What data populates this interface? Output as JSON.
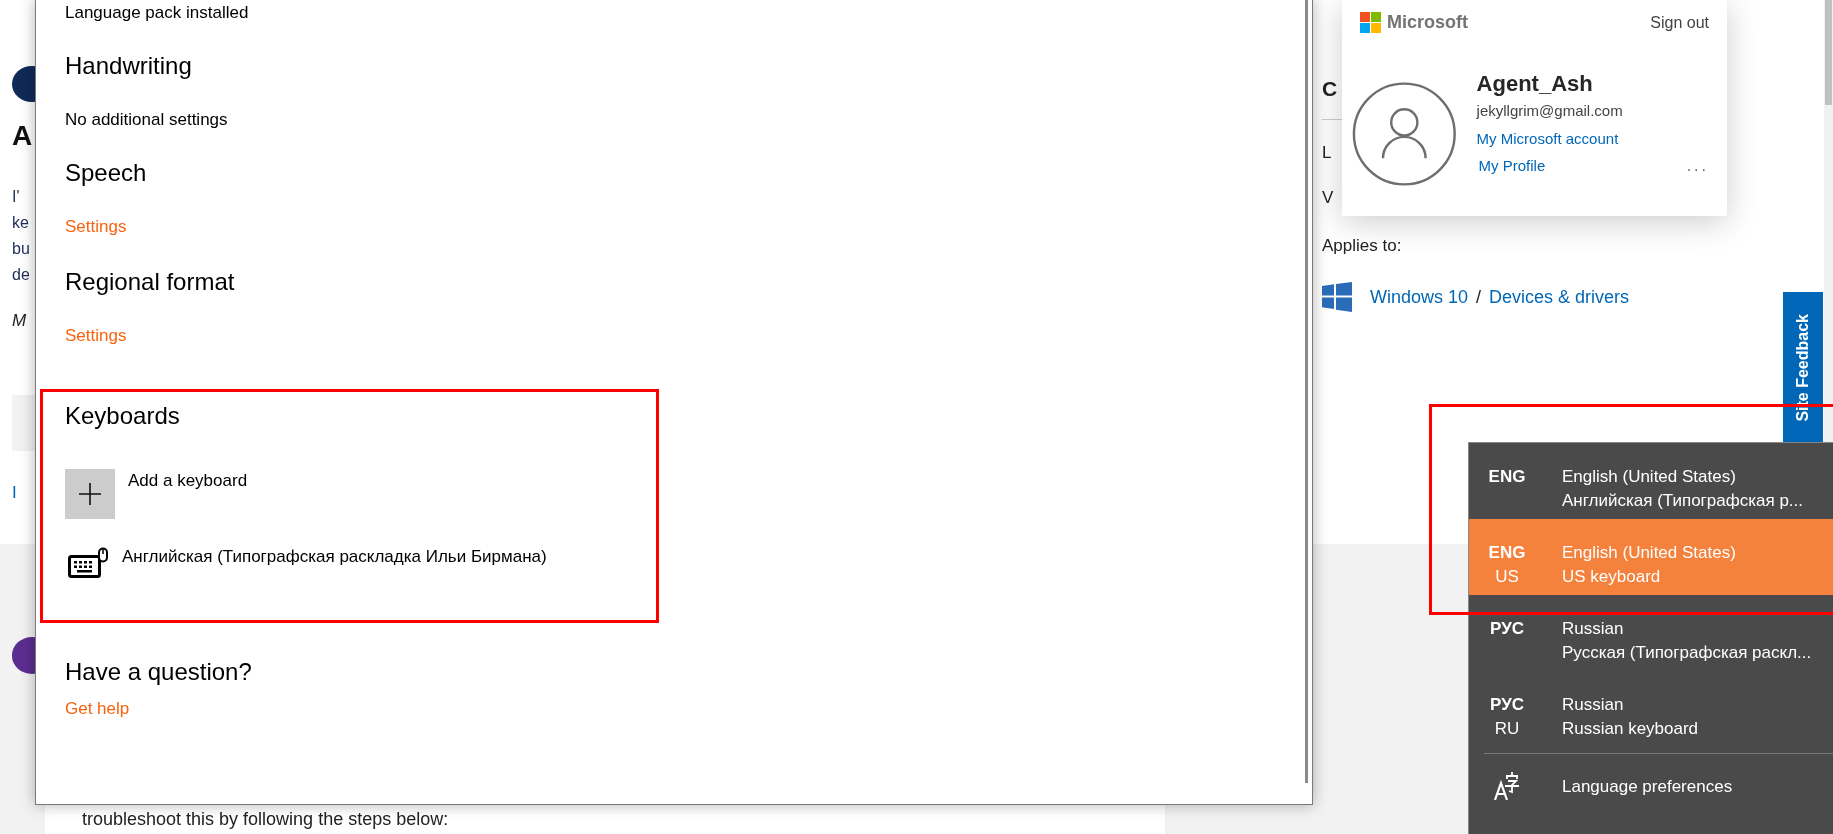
{
  "background_page": {
    "left_fragments": [
      {
        "kind": "avatar",
        "color": "#0f2a57"
      },
      {
        "kind": "heading",
        "text": "A"
      },
      {
        "kind": "text",
        "text": "I'"
      },
      {
        "kind": "text",
        "text": "ke"
      },
      {
        "kind": "text",
        "text": "bu"
      },
      {
        "kind": "text",
        "text": "de"
      },
      {
        "kind": "italic",
        "text": "M"
      },
      {
        "kind": "panel"
      },
      {
        "kind": "link",
        "text": "I"
      },
      {
        "kind": "avatar",
        "color": "#5c2d91"
      }
    ],
    "right_fragments": [
      {
        "kind": "heading",
        "text": "C"
      },
      {
        "kind": "rule"
      },
      {
        "kind": "text",
        "text": "L"
      },
      {
        "kind": "text",
        "text": "V"
      }
    ],
    "applies_to": {
      "label": "Applies to:",
      "products": [
        "Windows 10",
        "Devices & drivers"
      ],
      "separator": "/"
    },
    "article_text": "troubleshoot this by following the steps below:"
  },
  "settings_window": {
    "sections": [
      {
        "kind": "note",
        "text": "Language pack installed"
      },
      {
        "kind": "heading",
        "text": "Handwriting"
      },
      {
        "kind": "note",
        "text": "No additional settings"
      },
      {
        "kind": "heading",
        "text": "Speech"
      },
      {
        "kind": "link",
        "text": "Settings"
      },
      {
        "kind": "heading",
        "text": "Regional format"
      },
      {
        "kind": "link",
        "text": "Settings"
      }
    ],
    "keyboards": {
      "title": "Keyboards",
      "add_label": "Add a keyboard",
      "items": [
        "Английская (Типографская раскладка Ильи Бирмана)"
      ],
      "highlighted": true
    },
    "help": {
      "title": "Have a question?",
      "link": "Get help"
    }
  },
  "account_card": {
    "brand": "Microsoft",
    "sign_out": "Sign out",
    "name": "Agent_Ash",
    "email": "jekyllgrim@gmail.com",
    "account_link": "My Microsoft account",
    "profile_link": "My Profile",
    "more": "..."
  },
  "site_feedback": {
    "label": "Site Feedback"
  },
  "language_flyout": {
    "highlighted": true,
    "items": [
      {
        "code": "ENG",
        "language": "English (United States)",
        "layout": "Английская (Типографская р...",
        "selected": false
      },
      {
        "code": "ENG",
        "variant": "US",
        "language": "English (United States)",
        "layout": "US keyboard",
        "selected": true
      },
      {
        "code": "РУС",
        "language": "Russian",
        "layout": "Русская (Типографская раскл...",
        "selected": false
      },
      {
        "code": "РУС",
        "variant": "RU",
        "language": "Russian",
        "layout": "Russian keyboard",
        "selected": false
      }
    ],
    "preferences": "Language preferences"
  }
}
